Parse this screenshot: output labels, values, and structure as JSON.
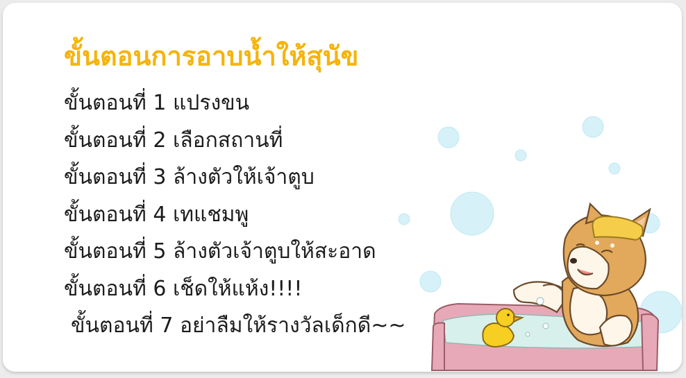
{
  "title": "ขั้นตอนการอาบน้ำให้สุนัข",
  "steps": [
    "ขั้นตอนที่ 1 แปรงขน",
    "ขั้นตอนที่ 2 เลือกสถานที่",
    "ขั้นตอนที่ 3 ล้างตัวให้เจ้าตูบ",
    "ขั้นตอนที่ 4 เทแชมพู",
    "ขั้นตอนที่ 5 ล้างตัวเจ้าตูบให้สะอาด",
    "ขั้นตอนที่ 6 เช็ดให้แห้ง!!!!",
    "ขั้นตอนที่ 7 อย่าลืมให้รางวัลเด็กดี~~"
  ],
  "colors": {
    "title": "#f5b40c",
    "text": "#1c1c1c",
    "bubble": "#d6f1f8",
    "tub": "#e7a9b7",
    "water": "#d8f0ec",
    "dog": "#e2a95c",
    "duck": "#f7cf22"
  },
  "illustration": "shiba-dog-bathing-in-pink-tub-with-rubber-duck-and-bubbles"
}
